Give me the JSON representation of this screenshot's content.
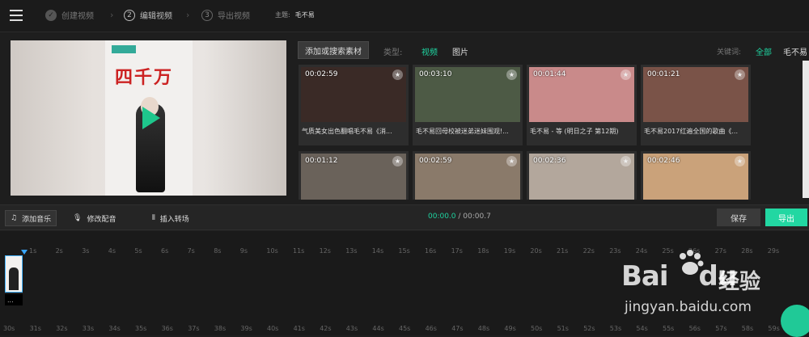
{
  "header": {
    "steps": [
      {
        "label": "创建视频",
        "state": "done"
      },
      {
        "label": "编辑视频",
        "number": "2",
        "state": "active"
      },
      {
        "label": "导出视频",
        "number": "3",
        "state": "pending"
      }
    ],
    "subject_label": "主题:",
    "subject_value": "毛不易"
  },
  "library": {
    "add_button": "添加或搜索素材",
    "type_label": "类型:",
    "type_video": "视频",
    "type_image": "图片",
    "keyword_label": "关键词:",
    "keyword_all": "全部",
    "keyword_mao": "毛不易",
    "cards": [
      {
        "duration": "00:02:59",
        "title": "气质美女出色翻唱毛不易《消...",
        "bg": "#3a2a26"
      },
      {
        "duration": "00:03:10",
        "title": "毛不易回母校被迷弟迷妹围观!...",
        "bg": "#4d5a45"
      },
      {
        "duration": "00:01:44",
        "title": "毛不易 - 等 (明日之子 第12期)",
        "bg": "#c98a8a"
      },
      {
        "duration": "00:01:21",
        "title": "毛不易2017红遍全国的歌曲《...",
        "bg": "#7a5348"
      },
      {
        "duration": "00:01:12",
        "title": "",
        "bg": "#6a625a"
      },
      {
        "duration": "00:02:59",
        "title": "",
        "bg": "#8a7a6a"
      },
      {
        "duration": "00:02:36",
        "title": "",
        "bg": "#b3a79c"
      },
      {
        "duration": "00:02:46",
        "title": "",
        "bg": "#caa27a"
      }
    ]
  },
  "toolbar": {
    "add_music": "添加音乐",
    "edit_voice": "修改配音",
    "insert_transition": "插入转场",
    "time_current": "00:00.0",
    "time_total": "/ 00:00.7",
    "save": "保存",
    "export": "导出"
  },
  "timeline": {
    "ruler_top": [
      "1s",
      "2s",
      "3s",
      "4s",
      "5s",
      "6s",
      "7s",
      "8s",
      "9s",
      "10s",
      "11s",
      "12s",
      "13s",
      "14s",
      "15s",
      "16s",
      "17s",
      "18s",
      "19s",
      "20s",
      "21s",
      "22s",
      "23s",
      "24s",
      "25s",
      "26s",
      "27s",
      "28s",
      "29s"
    ],
    "ruler_bottom": [
      "30s",
      "31s",
      "32s",
      "33s",
      "34s",
      "35s",
      "36s",
      "37s",
      "38s",
      "39s",
      "40s",
      "41s",
      "42s",
      "43s",
      "44s",
      "45s",
      "46s",
      "47s",
      "48s",
      "49s",
      "50s",
      "51s",
      "52s",
      "53s",
      "54s",
      "55s",
      "56s",
      "57s",
      "58s",
      "59s"
    ],
    "clip_label": "..."
  },
  "watermark": {
    "logo": "Bai",
    "logo2": "du",
    "cn": "经验",
    "url": "jingyan.baidu.com"
  },
  "poster": {
    "title": "四千万"
  }
}
